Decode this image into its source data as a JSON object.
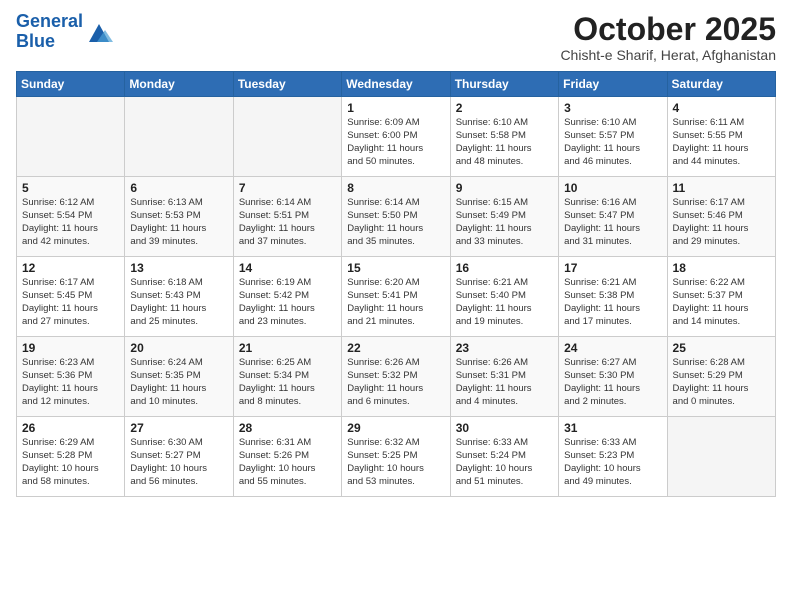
{
  "header": {
    "logo_general": "General",
    "logo_blue": "Blue",
    "main_title": "October 2025",
    "subtitle": "Chisht-e Sharif, Herat, Afghanistan"
  },
  "weekdays": [
    "Sunday",
    "Monday",
    "Tuesday",
    "Wednesday",
    "Thursday",
    "Friday",
    "Saturday"
  ],
  "weeks": [
    [
      {
        "day": "",
        "info": ""
      },
      {
        "day": "",
        "info": ""
      },
      {
        "day": "",
        "info": ""
      },
      {
        "day": "1",
        "info": "Sunrise: 6:09 AM\nSunset: 6:00 PM\nDaylight: 11 hours\nand 50 minutes."
      },
      {
        "day": "2",
        "info": "Sunrise: 6:10 AM\nSunset: 5:58 PM\nDaylight: 11 hours\nand 48 minutes."
      },
      {
        "day": "3",
        "info": "Sunrise: 6:10 AM\nSunset: 5:57 PM\nDaylight: 11 hours\nand 46 minutes."
      },
      {
        "day": "4",
        "info": "Sunrise: 6:11 AM\nSunset: 5:55 PM\nDaylight: 11 hours\nand 44 minutes."
      }
    ],
    [
      {
        "day": "5",
        "info": "Sunrise: 6:12 AM\nSunset: 5:54 PM\nDaylight: 11 hours\nand 42 minutes."
      },
      {
        "day": "6",
        "info": "Sunrise: 6:13 AM\nSunset: 5:53 PM\nDaylight: 11 hours\nand 39 minutes."
      },
      {
        "day": "7",
        "info": "Sunrise: 6:14 AM\nSunset: 5:51 PM\nDaylight: 11 hours\nand 37 minutes."
      },
      {
        "day": "8",
        "info": "Sunrise: 6:14 AM\nSunset: 5:50 PM\nDaylight: 11 hours\nand 35 minutes."
      },
      {
        "day": "9",
        "info": "Sunrise: 6:15 AM\nSunset: 5:49 PM\nDaylight: 11 hours\nand 33 minutes."
      },
      {
        "day": "10",
        "info": "Sunrise: 6:16 AM\nSunset: 5:47 PM\nDaylight: 11 hours\nand 31 minutes."
      },
      {
        "day": "11",
        "info": "Sunrise: 6:17 AM\nSunset: 5:46 PM\nDaylight: 11 hours\nand 29 minutes."
      }
    ],
    [
      {
        "day": "12",
        "info": "Sunrise: 6:17 AM\nSunset: 5:45 PM\nDaylight: 11 hours\nand 27 minutes."
      },
      {
        "day": "13",
        "info": "Sunrise: 6:18 AM\nSunset: 5:43 PM\nDaylight: 11 hours\nand 25 minutes."
      },
      {
        "day": "14",
        "info": "Sunrise: 6:19 AM\nSunset: 5:42 PM\nDaylight: 11 hours\nand 23 minutes."
      },
      {
        "day": "15",
        "info": "Sunrise: 6:20 AM\nSunset: 5:41 PM\nDaylight: 11 hours\nand 21 minutes."
      },
      {
        "day": "16",
        "info": "Sunrise: 6:21 AM\nSunset: 5:40 PM\nDaylight: 11 hours\nand 19 minutes."
      },
      {
        "day": "17",
        "info": "Sunrise: 6:21 AM\nSunset: 5:38 PM\nDaylight: 11 hours\nand 17 minutes."
      },
      {
        "day": "18",
        "info": "Sunrise: 6:22 AM\nSunset: 5:37 PM\nDaylight: 11 hours\nand 14 minutes."
      }
    ],
    [
      {
        "day": "19",
        "info": "Sunrise: 6:23 AM\nSunset: 5:36 PM\nDaylight: 11 hours\nand 12 minutes."
      },
      {
        "day": "20",
        "info": "Sunrise: 6:24 AM\nSunset: 5:35 PM\nDaylight: 11 hours\nand 10 minutes."
      },
      {
        "day": "21",
        "info": "Sunrise: 6:25 AM\nSunset: 5:34 PM\nDaylight: 11 hours\nand 8 minutes."
      },
      {
        "day": "22",
        "info": "Sunrise: 6:26 AM\nSunset: 5:32 PM\nDaylight: 11 hours\nand 6 minutes."
      },
      {
        "day": "23",
        "info": "Sunrise: 6:26 AM\nSunset: 5:31 PM\nDaylight: 11 hours\nand 4 minutes."
      },
      {
        "day": "24",
        "info": "Sunrise: 6:27 AM\nSunset: 5:30 PM\nDaylight: 11 hours\nand 2 minutes."
      },
      {
        "day": "25",
        "info": "Sunrise: 6:28 AM\nSunset: 5:29 PM\nDaylight: 11 hours\nand 0 minutes."
      }
    ],
    [
      {
        "day": "26",
        "info": "Sunrise: 6:29 AM\nSunset: 5:28 PM\nDaylight: 10 hours\nand 58 minutes."
      },
      {
        "day": "27",
        "info": "Sunrise: 6:30 AM\nSunset: 5:27 PM\nDaylight: 10 hours\nand 56 minutes."
      },
      {
        "day": "28",
        "info": "Sunrise: 6:31 AM\nSunset: 5:26 PM\nDaylight: 10 hours\nand 55 minutes."
      },
      {
        "day": "29",
        "info": "Sunrise: 6:32 AM\nSunset: 5:25 PM\nDaylight: 10 hours\nand 53 minutes."
      },
      {
        "day": "30",
        "info": "Sunrise: 6:33 AM\nSunset: 5:24 PM\nDaylight: 10 hours\nand 51 minutes."
      },
      {
        "day": "31",
        "info": "Sunrise: 6:33 AM\nSunset: 5:23 PM\nDaylight: 10 hours\nand 49 minutes."
      },
      {
        "day": "",
        "info": ""
      }
    ]
  ]
}
